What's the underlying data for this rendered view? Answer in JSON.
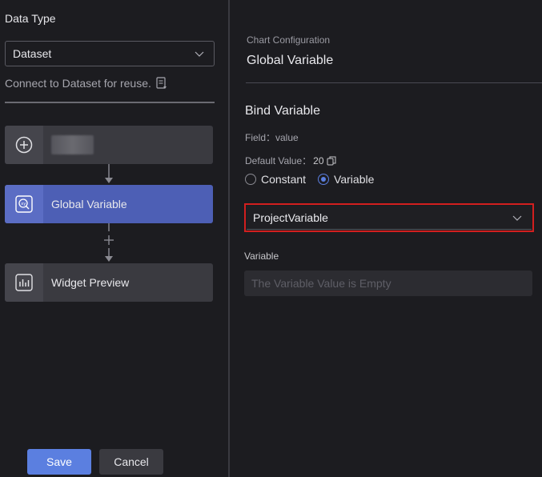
{
  "left_panel": {
    "data_type_label": "Data Type",
    "data_type_value": "Dataset",
    "connect_text": "Connect to Dataset for reuse.",
    "nodes": [
      {
        "label": "",
        "icon": "add-circle-icon",
        "active": false
      },
      {
        "label": "Global Variable",
        "icon": "global-variable-icon",
        "active": true
      },
      {
        "label": "Widget Preview",
        "icon": "chart-preview-icon",
        "active": false
      }
    ],
    "save_label": "Save",
    "cancel_label": "Cancel"
  },
  "right_panel": {
    "section_caption": "Chart Configuration",
    "section_title": "Global Variable",
    "bind_title": "Bind Variable",
    "field_text": "Field：value",
    "default_value_label": "Default Value：",
    "default_value": "20",
    "radio_options": [
      {
        "label": "Constant",
        "selected": false
      },
      {
        "label": "Variable",
        "selected": true
      }
    ],
    "variable_select_value": "ProjectVariable",
    "variable_label": "Variable",
    "variable_placeholder": "The Variable Value is Empty"
  },
  "colors": {
    "accent": "#5b7fe0",
    "active_node": "#4d5fb5",
    "highlight_border": "#d21f1f",
    "background": "#1c1c20"
  }
}
